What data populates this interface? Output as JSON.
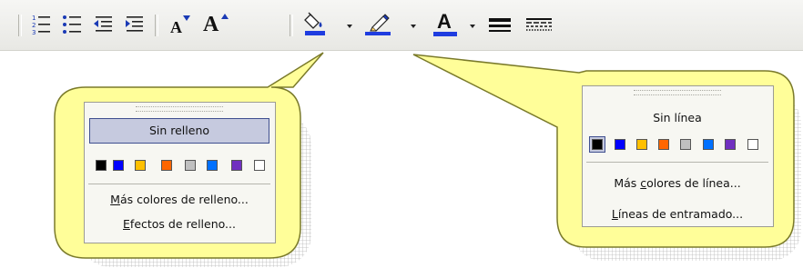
{
  "toolbar": {
    "buttons": [
      {
        "name": "numbered-list-icon"
      },
      {
        "name": "bulleted-list-icon"
      },
      {
        "name": "decrease-indent-icon"
      },
      {
        "name": "increase-indent-icon"
      },
      {
        "name": "decrease-font-size-icon",
        "glyph": "A"
      },
      {
        "name": "increase-font-size-icon",
        "glyph": "A"
      },
      {
        "name": "fill-color-icon",
        "color": "#1f3de0"
      },
      {
        "name": "line-color-icon",
        "color": "#1f3de0"
      },
      {
        "name": "font-color-icon",
        "glyph": "A",
        "color": "#1f3de0"
      },
      {
        "name": "line-style-icon"
      },
      {
        "name": "dash-style-icon"
      }
    ]
  },
  "fill_menu": {
    "no_fill": "Sin relleno",
    "colors": [
      "#000000",
      "#0000ff",
      "#ffc000",
      "#ff6600",
      "#c0c0c0",
      "#0070ff",
      "#7030c0",
      "#ffffff"
    ],
    "more_colors": "Más colores de relleno...",
    "more_colors_access_key": "M",
    "effects": "Efectos de relleno...",
    "effects_access_key": "E"
  },
  "line_menu": {
    "no_line": "Sin línea",
    "colors": [
      "#000000",
      "#0000ff",
      "#ffc000",
      "#ff6600",
      "#c0c0c0",
      "#0070ff",
      "#7030c0",
      "#ffffff"
    ],
    "more_colors": "Más colores de línea...",
    "more_colors_access_key": "c",
    "patterned_lines": "Líneas de entramado...",
    "patterned_lines_access_key": "L"
  },
  "colors": {
    "callout_fill": "#fffe99",
    "callout_border": "#7a7a2a",
    "highlight": "#c6cadf",
    "accent": "#1f3de0"
  }
}
